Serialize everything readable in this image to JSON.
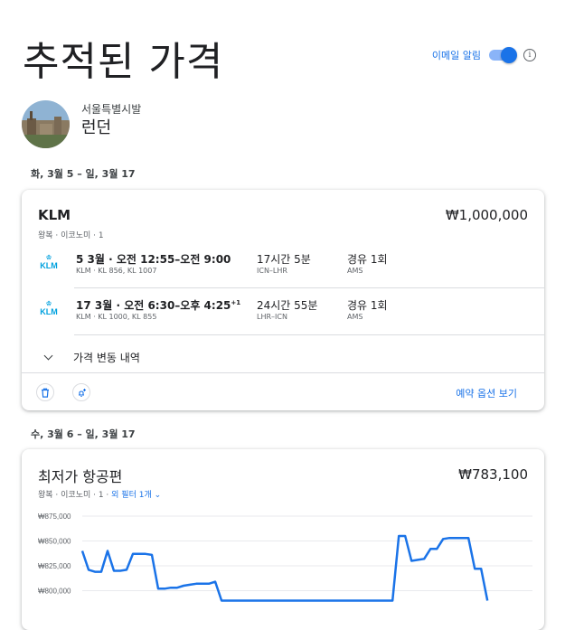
{
  "page": {
    "title": "추적된 가격"
  },
  "email_alert": {
    "label": "이메일 알림",
    "enabled": true
  },
  "route": {
    "from": "서울특별시발",
    "to": "런던"
  },
  "trip1": {
    "dates": "화, 3월 5 – 일, 3월 17",
    "airline": "KLM",
    "price": "₩1,000,000",
    "meta": "왕복 · 이코노미 · 1",
    "legs": [
      {
        "logo": "KLM",
        "date": "5 3월",
        "time": " · 오전 12:55–오전 9:00",
        "plus": "",
        "flights": "KLM · KL 856, KL 1007",
        "duration": "17시간 5분",
        "airports": "ICN–LHR",
        "stops": "경유 1회",
        "via": "AMS"
      },
      {
        "logo": "KLM",
        "date": "17 3월",
        "time": " · 오전 6:30–오후 4:25",
        "plus": "+1",
        "flights": "KLM · KL 1000, KL 855",
        "duration": "24시간 55분",
        "airports": "LHR–ICN",
        "stops": "경유 1회",
        "via": "AMS"
      }
    ],
    "history_label": "가격 변동 내역",
    "booking_label": "예약 옵션 보기"
  },
  "trip2": {
    "dates": "수, 3월 6 – 일, 3월 17",
    "title": "최저가 항공편",
    "price": "₩783,100",
    "meta_prefix": "왕복 · 이코노미 · 1 · ",
    "filter_label": "외 필터 1개"
  },
  "chart_data": {
    "type": "line",
    "y_ticks": [
      "₩875,000",
      "₩850,000",
      "₩825,000",
      "₩800,000"
    ],
    "ylim": [
      790000,
      880000
    ],
    "color": "#1a73e8",
    "values": [
      840000,
      821000,
      819000,
      819000,
      840000,
      820000,
      820000,
      821000,
      837000,
      837000,
      837000,
      836000,
      802000,
      802000,
      803000,
      803000,
      805000,
      806000,
      807000,
      807000,
      807000,
      809000,
      790000,
      790000,
      790000,
      790000,
      790000,
      790000,
      790000,
      790000,
      790000,
      790000,
      790000,
      790000,
      790000,
      790000,
      790000,
      790000,
      790000,
      790000,
      790000,
      790000,
      790000,
      790000,
      790000,
      790000,
      790000,
      790000,
      790000,
      790000,
      855000,
      855000,
      830000,
      831000,
      832000,
      842000,
      842000,
      852000,
      853000,
      853000,
      853000,
      853000,
      822000,
      822000,
      790000
    ]
  }
}
